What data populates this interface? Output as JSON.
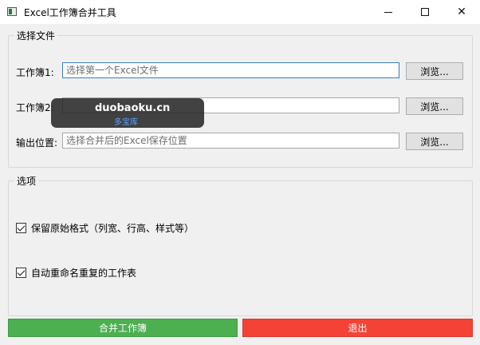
{
  "window": {
    "title": "Excel工作簿合并工具",
    "minimize_icon": "minimize-icon",
    "maximize_icon": "maximize-icon",
    "close_icon": "close-icon"
  },
  "files_group": {
    "title": "选择文件",
    "workbook1": {
      "label": "工作簿1:",
      "value": "",
      "placeholder": "选择第一个Excel文件",
      "browse": "浏览..."
    },
    "workbook2": {
      "label": "工作簿2:",
      "value": "",
      "placeholder": "",
      "browse": "浏览..."
    },
    "output": {
      "label": "输出位置:",
      "value": "",
      "placeholder": "选择合并后的Excel保存位置",
      "browse": "浏览..."
    }
  },
  "options_group": {
    "title": "选项",
    "keep_format": {
      "label": "保留原始格式（列宽、行高、样式等）",
      "checked": true
    },
    "auto_rename": {
      "label": "自动重命名重复的工作表",
      "checked": true
    }
  },
  "actions": {
    "merge": {
      "label": "合并工作簿",
      "color": "#4caf50"
    },
    "exit": {
      "label": "退出",
      "color": "#f44336"
    }
  },
  "watermark": {
    "main": "duobaoku.cn",
    "sub": "多宝库"
  }
}
